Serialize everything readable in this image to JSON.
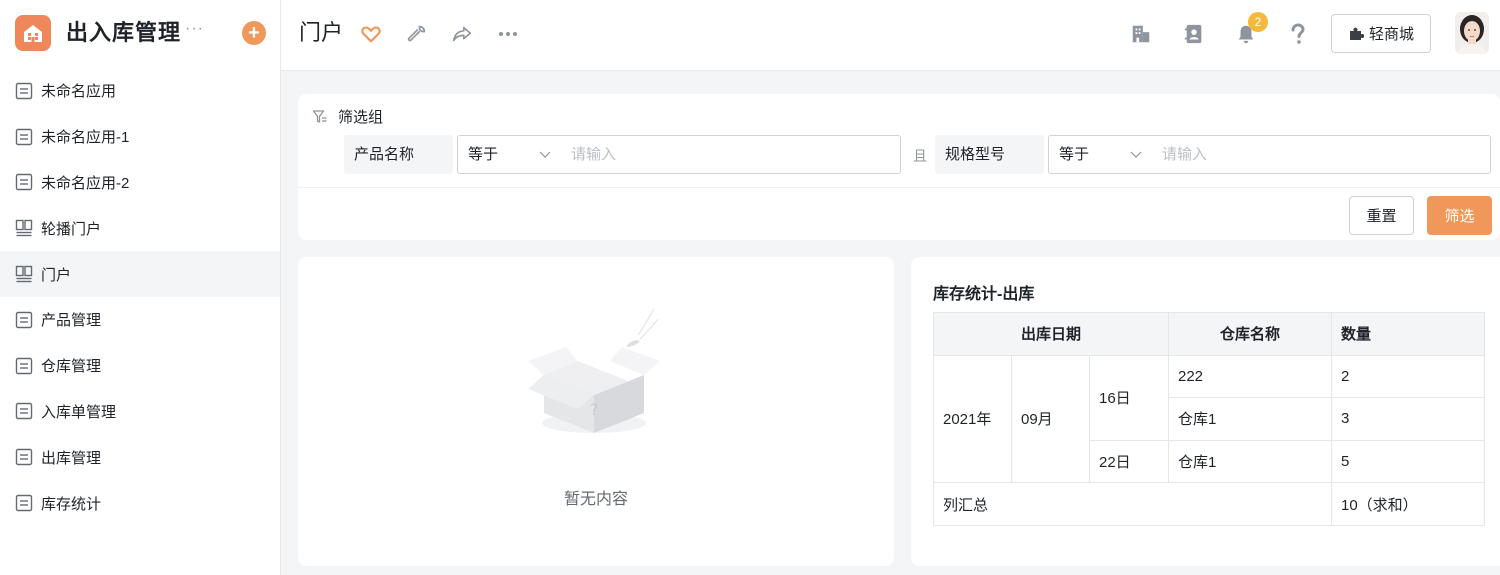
{
  "app": {
    "title": "出入库管理",
    "more": "···",
    "add": "+"
  },
  "sidebar": {
    "items": [
      {
        "label": "未命名应用",
        "icon": "form-icon"
      },
      {
        "label": "未命名应用-1",
        "icon": "form-icon"
      },
      {
        "label": "未命名应用-2",
        "icon": "form-icon"
      },
      {
        "label": "轮播门户",
        "icon": "portal-icon"
      },
      {
        "label": "门户",
        "icon": "portal-icon",
        "active": true
      },
      {
        "label": "产品管理",
        "icon": "form-icon"
      },
      {
        "label": "仓库管理",
        "icon": "form-icon"
      },
      {
        "label": "入库单管理",
        "icon": "form-icon"
      },
      {
        "label": "出库管理",
        "icon": "form-icon"
      },
      {
        "label": "库存统计",
        "icon": "form-icon"
      }
    ]
  },
  "topbar": {
    "page_title": "门户",
    "notification_count": "2",
    "shop_label": "轻商城"
  },
  "filter": {
    "group_label": "筛选组",
    "conditions": [
      {
        "field": "产品名称",
        "operator": "等于",
        "placeholder": "请输入"
      },
      {
        "field": "规格型号",
        "operator": "等于",
        "placeholder": "请输入"
      }
    ],
    "and_label": "且",
    "reset_label": "重置",
    "submit_label": "筛选"
  },
  "empty_state": {
    "text": "暂无内容"
  },
  "stats": {
    "title": "库存统计-出库",
    "headers": {
      "date": "出库日期",
      "warehouse": "仓库名称",
      "quantity": "数量"
    },
    "year": "2021年",
    "month": "09月",
    "days": [
      {
        "day": "16日",
        "rows": [
          {
            "warehouse": "222",
            "quantity": "2"
          },
          {
            "warehouse": "仓库1",
            "quantity": "3"
          }
        ]
      },
      {
        "day": "22日",
        "rows": [
          {
            "warehouse": "仓库1",
            "quantity": "5"
          }
        ]
      }
    ],
    "total_label": "列汇总",
    "total_value": "10（求和）"
  },
  "colors": {
    "accent": "#f0985a",
    "badge": "#f5b83d",
    "logo": "#f0875a"
  }
}
